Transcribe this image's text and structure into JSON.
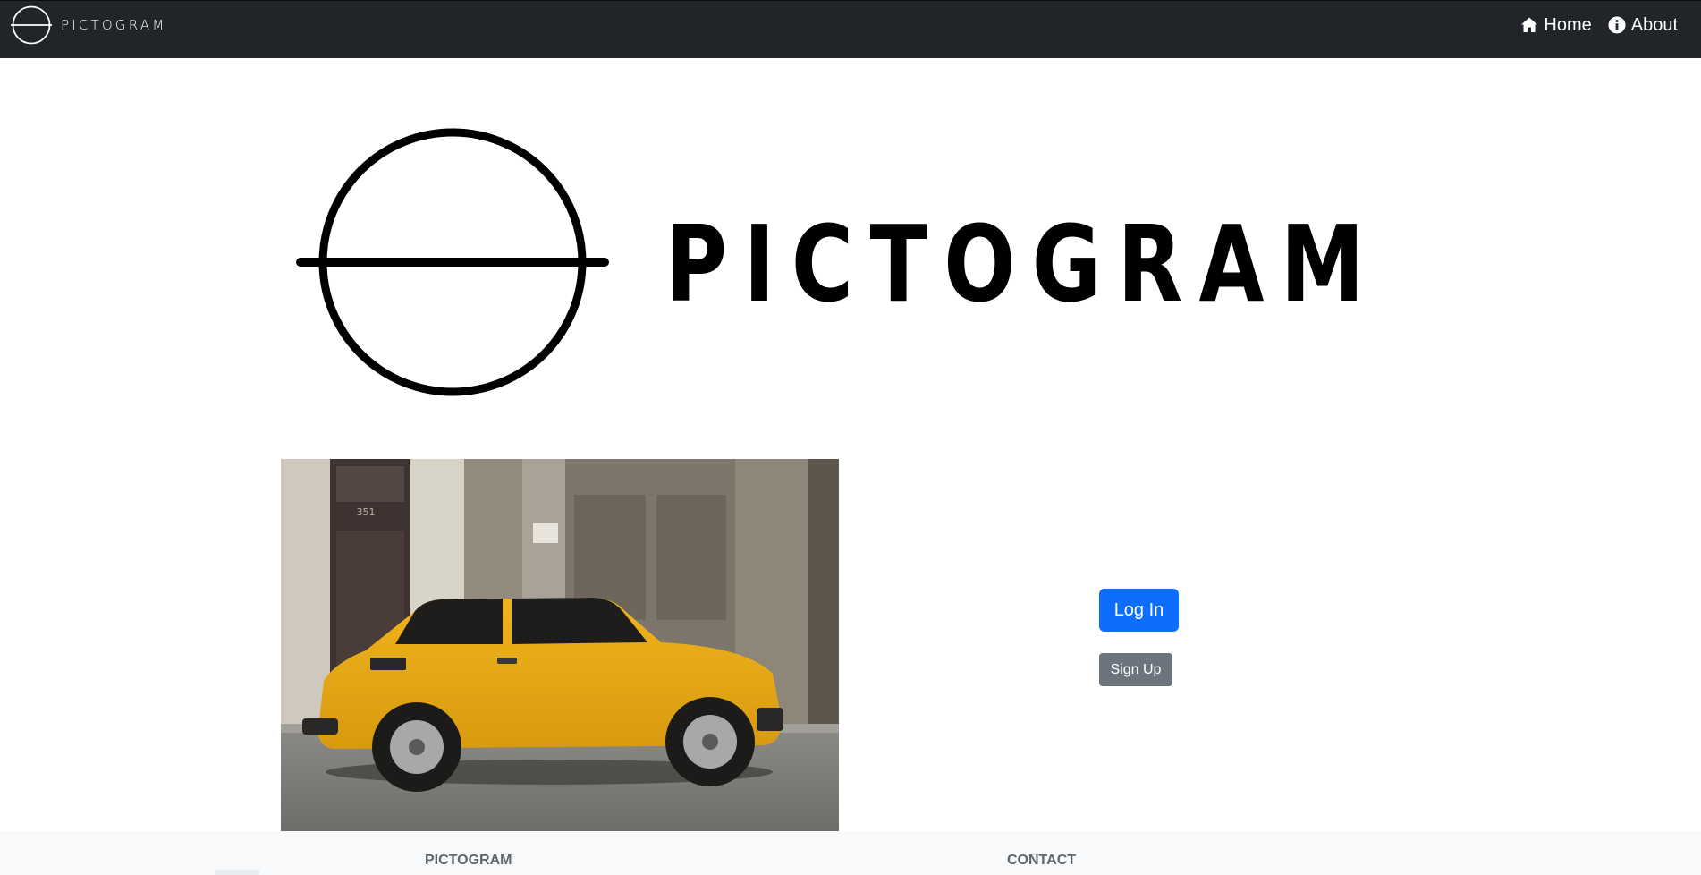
{
  "navbar": {
    "brand_text": "PICTOGRAM",
    "logo_icon": "pictogram-logo-icon",
    "links": [
      {
        "label": "Home",
        "icon": "home-icon"
      },
      {
        "label": "About",
        "icon": "info-icon"
      }
    ]
  },
  "hero": {
    "logo_text": "PICTOGRAM",
    "logo_icon": "pictogram-logo-icon"
  },
  "photo": {
    "subject": "yellow-car-photo",
    "door_number": "351"
  },
  "actions": {
    "login_label": "Log In",
    "signup_label": "Sign Up"
  },
  "footer": {
    "headings": [
      "PICTOGRAM",
      "CONTACT"
    ]
  },
  "colors": {
    "navbar_bg": "#212529",
    "primary": "#0d6efd",
    "secondary": "#6c757d",
    "footer_bg": "#f8f9fa"
  }
}
